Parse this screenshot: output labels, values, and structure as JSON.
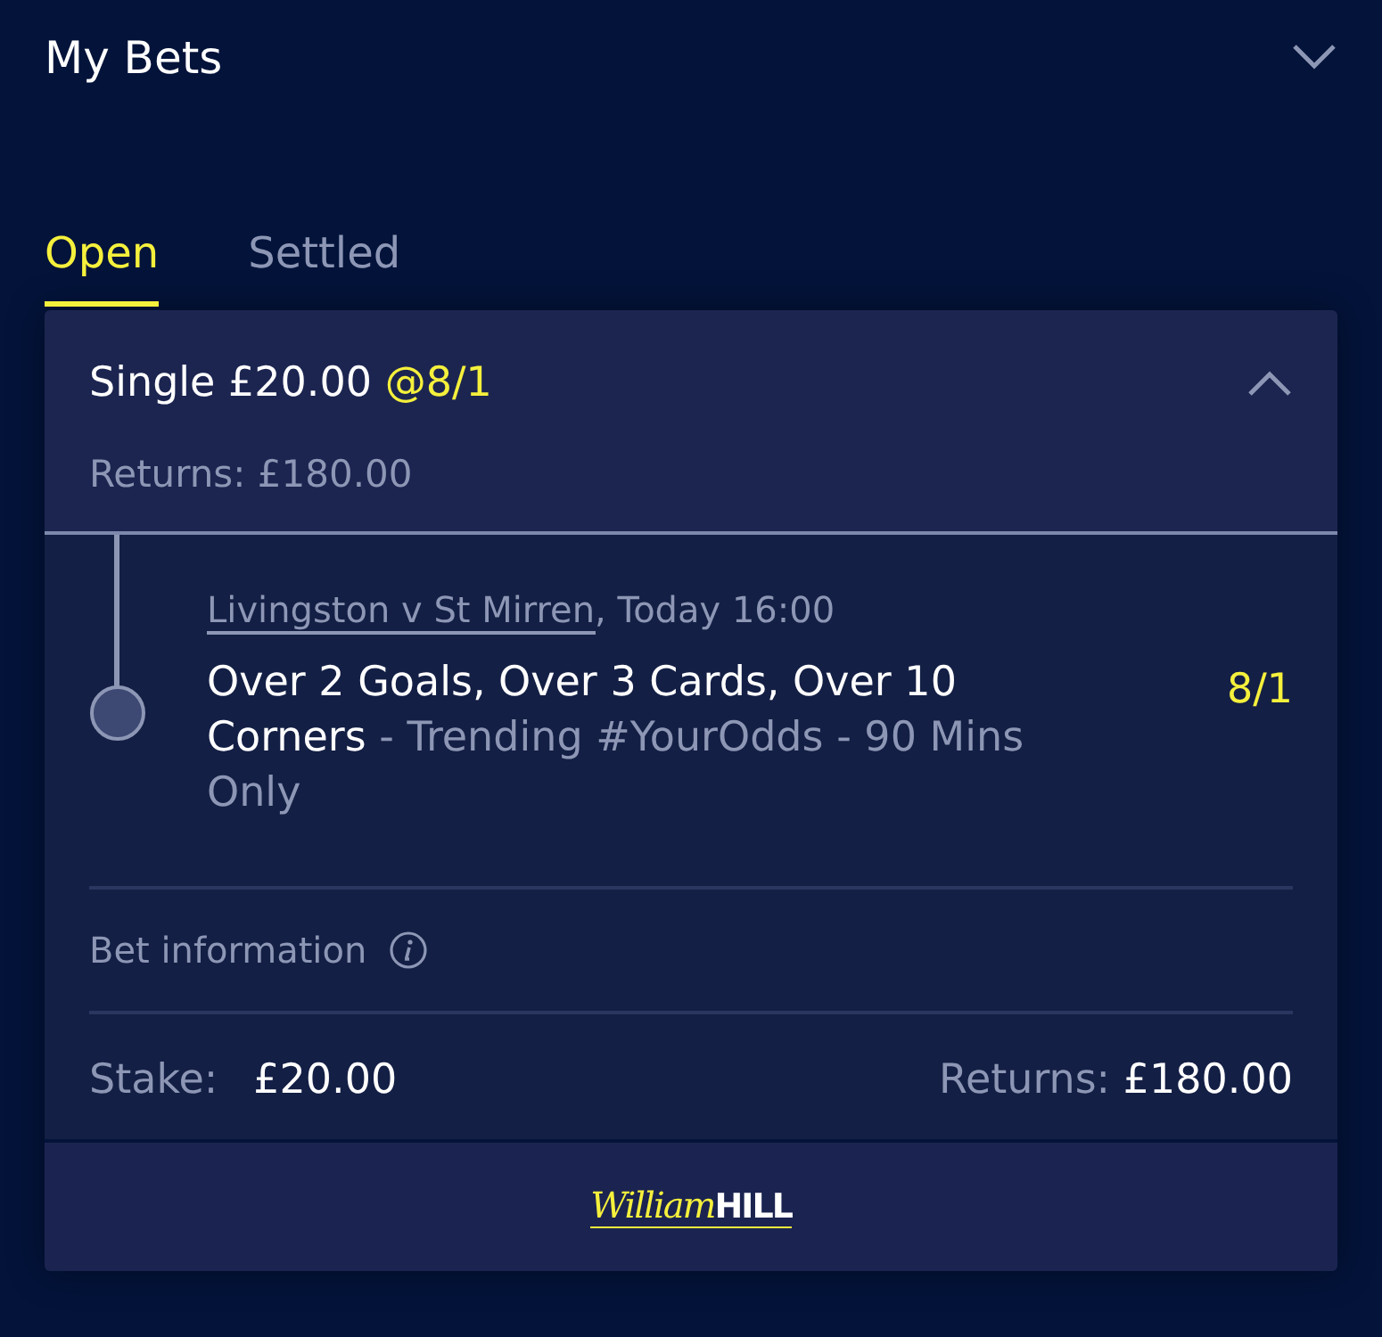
{
  "header": {
    "title": "My Bets"
  },
  "tabs": [
    {
      "label": "Open",
      "selected": true
    },
    {
      "label": "Settled",
      "selected": false
    }
  ],
  "bet": {
    "title": "Single £20.00",
    "odds": "@8/1",
    "expanded": true,
    "returns": "Returns: £180.00",
    "selection": {
      "event": "Livingston v St Mirren",
      "time": ", Today 16:00",
      "market": "Over 2 Goals, Over 3 Cards, Over 10 Corners",
      "detail": " - Trending #YourOdds - 90 Mins Only",
      "odds": "8/1"
    },
    "info_label": "Bet information",
    "stake_label": "Stake:",
    "stake": "£20.00",
    "returns_label": "Returns:",
    "returns_value": "£180.00"
  },
  "footer": {
    "logo_script": "William",
    "logo_bold": "HILL"
  }
}
